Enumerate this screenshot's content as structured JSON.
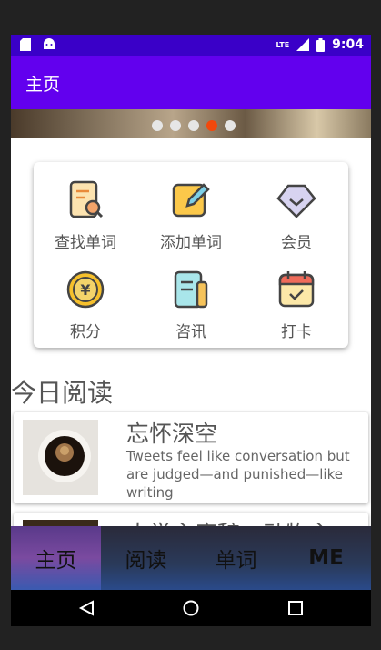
{
  "status_bar": {
    "time": "9:04",
    "network": "LTE",
    "icons": [
      "sdcard-icon",
      "android-icon",
      "signal-icon",
      "battery-icon"
    ]
  },
  "app_bar": {
    "title": "主页"
  },
  "banner": {
    "page_count": 5,
    "active_index": 3
  },
  "features": [
    {
      "label": "查找单词",
      "icon": "search-word-icon"
    },
    {
      "label": "添加单词",
      "icon": "add-word-icon"
    },
    {
      "label": "会员",
      "icon": "vip-diamond-icon"
    },
    {
      "label": "积分",
      "icon": "coin-icon"
    },
    {
      "label": "咨讯",
      "icon": "news-icon"
    },
    {
      "label": "打卡",
      "icon": "checkin-calendar-icon"
    }
  ],
  "section_title": "今日阅读",
  "articles": [
    {
      "title": "忘怀深空",
      "description": "Tweets feel like conversation but are judged—and punished—like writing"
    },
    {
      "title": "大学主席辞，动物主",
      "description": ""
    }
  ],
  "bottom_nav": [
    {
      "label": "主页",
      "active": true
    },
    {
      "label": "阅读",
      "active": false
    },
    {
      "label": "单词",
      "active": false
    },
    {
      "label": "ME",
      "active": false
    }
  ],
  "colors": {
    "status_bar": "#3a00c8",
    "app_bar": "#6200ee",
    "active_dot": "#f2480c"
  }
}
